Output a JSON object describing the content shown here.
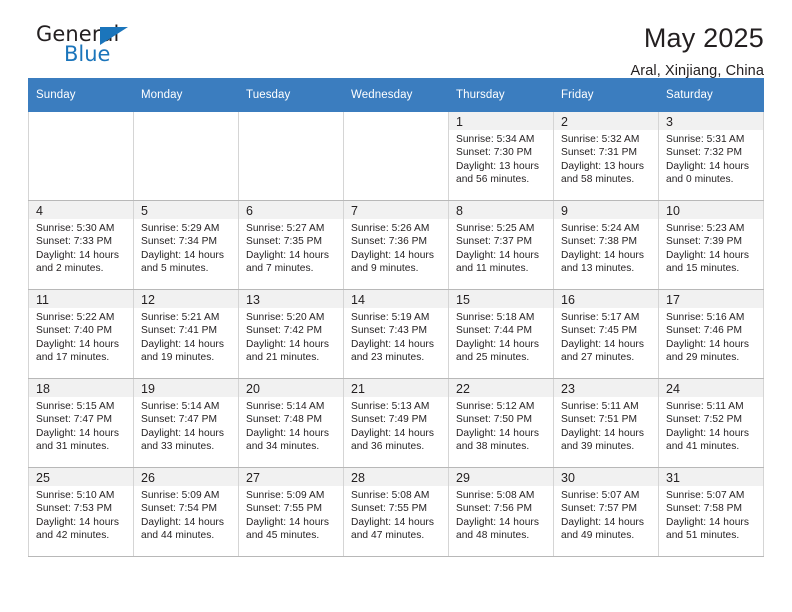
{
  "brand": {
    "name_top": "General",
    "name_bottom": "Blue",
    "accent_color": "#1b75bb"
  },
  "header": {
    "title": "May 2025",
    "subtitle": "Aral, Xinjiang, China"
  },
  "theme": {
    "header_row_color": "#3b7dbf",
    "header_text_color": "#ffffff",
    "cell_shade_color": "#f1f1f1",
    "grid_line_color": "#b8b8b8"
  },
  "calendar": {
    "weekday_headers": [
      "Sunday",
      "Monday",
      "Tuesday",
      "Wednesday",
      "Thursday",
      "Friday",
      "Saturday"
    ],
    "weeks": [
      [
        {
          "empty": true
        },
        {
          "empty": true
        },
        {
          "empty": true
        },
        {
          "empty": true
        },
        {
          "day": "1",
          "sunrise": "Sunrise: 5:34 AM",
          "sunset": "Sunset: 7:30 PM",
          "daylight_line1": "Daylight: 13 hours",
          "daylight_line2": "and 56 minutes."
        },
        {
          "day": "2",
          "sunrise": "Sunrise: 5:32 AM",
          "sunset": "Sunset: 7:31 PM",
          "daylight_line1": "Daylight: 13 hours",
          "daylight_line2": "and 58 minutes."
        },
        {
          "day": "3",
          "sunrise": "Sunrise: 5:31 AM",
          "sunset": "Sunset: 7:32 PM",
          "daylight_line1": "Daylight: 14 hours",
          "daylight_line2": "and 0 minutes."
        }
      ],
      [
        {
          "day": "4",
          "sunrise": "Sunrise: 5:30 AM",
          "sunset": "Sunset: 7:33 PM",
          "daylight_line1": "Daylight: 14 hours",
          "daylight_line2": "and 2 minutes."
        },
        {
          "day": "5",
          "sunrise": "Sunrise: 5:29 AM",
          "sunset": "Sunset: 7:34 PM",
          "daylight_line1": "Daylight: 14 hours",
          "daylight_line2": "and 5 minutes."
        },
        {
          "day": "6",
          "sunrise": "Sunrise: 5:27 AM",
          "sunset": "Sunset: 7:35 PM",
          "daylight_line1": "Daylight: 14 hours",
          "daylight_line2": "and 7 minutes."
        },
        {
          "day": "7",
          "sunrise": "Sunrise: 5:26 AM",
          "sunset": "Sunset: 7:36 PM",
          "daylight_line1": "Daylight: 14 hours",
          "daylight_line2": "and 9 minutes."
        },
        {
          "day": "8",
          "sunrise": "Sunrise: 5:25 AM",
          "sunset": "Sunset: 7:37 PM",
          "daylight_line1": "Daylight: 14 hours",
          "daylight_line2": "and 11 minutes."
        },
        {
          "day": "9",
          "sunrise": "Sunrise: 5:24 AM",
          "sunset": "Sunset: 7:38 PM",
          "daylight_line1": "Daylight: 14 hours",
          "daylight_line2": "and 13 minutes."
        },
        {
          "day": "10",
          "sunrise": "Sunrise: 5:23 AM",
          "sunset": "Sunset: 7:39 PM",
          "daylight_line1": "Daylight: 14 hours",
          "daylight_line2": "and 15 minutes."
        }
      ],
      [
        {
          "day": "11",
          "sunrise": "Sunrise: 5:22 AM",
          "sunset": "Sunset: 7:40 PM",
          "daylight_line1": "Daylight: 14 hours",
          "daylight_line2": "and 17 minutes."
        },
        {
          "day": "12",
          "sunrise": "Sunrise: 5:21 AM",
          "sunset": "Sunset: 7:41 PM",
          "daylight_line1": "Daylight: 14 hours",
          "daylight_line2": "and 19 minutes."
        },
        {
          "day": "13",
          "sunrise": "Sunrise: 5:20 AM",
          "sunset": "Sunset: 7:42 PM",
          "daylight_line1": "Daylight: 14 hours",
          "daylight_line2": "and 21 minutes."
        },
        {
          "day": "14",
          "sunrise": "Sunrise: 5:19 AM",
          "sunset": "Sunset: 7:43 PM",
          "daylight_line1": "Daylight: 14 hours",
          "daylight_line2": "and 23 minutes."
        },
        {
          "day": "15",
          "sunrise": "Sunrise: 5:18 AM",
          "sunset": "Sunset: 7:44 PM",
          "daylight_line1": "Daylight: 14 hours",
          "daylight_line2": "and 25 minutes."
        },
        {
          "day": "16",
          "sunrise": "Sunrise: 5:17 AM",
          "sunset": "Sunset: 7:45 PM",
          "daylight_line1": "Daylight: 14 hours",
          "daylight_line2": "and 27 minutes."
        },
        {
          "day": "17",
          "sunrise": "Sunrise: 5:16 AM",
          "sunset": "Sunset: 7:46 PM",
          "daylight_line1": "Daylight: 14 hours",
          "daylight_line2": "and 29 minutes."
        }
      ],
      [
        {
          "day": "18",
          "sunrise": "Sunrise: 5:15 AM",
          "sunset": "Sunset: 7:47 PM",
          "daylight_line1": "Daylight: 14 hours",
          "daylight_line2": "and 31 minutes."
        },
        {
          "day": "19",
          "sunrise": "Sunrise: 5:14 AM",
          "sunset": "Sunset: 7:47 PM",
          "daylight_line1": "Daylight: 14 hours",
          "daylight_line2": "and 33 minutes."
        },
        {
          "day": "20",
          "sunrise": "Sunrise: 5:14 AM",
          "sunset": "Sunset: 7:48 PM",
          "daylight_line1": "Daylight: 14 hours",
          "daylight_line2": "and 34 minutes."
        },
        {
          "day": "21",
          "sunrise": "Sunrise: 5:13 AM",
          "sunset": "Sunset: 7:49 PM",
          "daylight_line1": "Daylight: 14 hours",
          "daylight_line2": "and 36 minutes."
        },
        {
          "day": "22",
          "sunrise": "Sunrise: 5:12 AM",
          "sunset": "Sunset: 7:50 PM",
          "daylight_line1": "Daylight: 14 hours",
          "daylight_line2": "and 38 minutes."
        },
        {
          "day": "23",
          "sunrise": "Sunrise: 5:11 AM",
          "sunset": "Sunset: 7:51 PM",
          "daylight_line1": "Daylight: 14 hours",
          "daylight_line2": "and 39 minutes."
        },
        {
          "day": "24",
          "sunrise": "Sunrise: 5:11 AM",
          "sunset": "Sunset: 7:52 PM",
          "daylight_line1": "Daylight: 14 hours",
          "daylight_line2": "and 41 minutes."
        }
      ],
      [
        {
          "day": "25",
          "sunrise": "Sunrise: 5:10 AM",
          "sunset": "Sunset: 7:53 PM",
          "daylight_line1": "Daylight: 14 hours",
          "daylight_line2": "and 42 minutes."
        },
        {
          "day": "26",
          "sunrise": "Sunrise: 5:09 AM",
          "sunset": "Sunset: 7:54 PM",
          "daylight_line1": "Daylight: 14 hours",
          "daylight_line2": "and 44 minutes."
        },
        {
          "day": "27",
          "sunrise": "Sunrise: 5:09 AM",
          "sunset": "Sunset: 7:55 PM",
          "daylight_line1": "Daylight: 14 hours",
          "daylight_line2": "and 45 minutes."
        },
        {
          "day": "28",
          "sunrise": "Sunrise: 5:08 AM",
          "sunset": "Sunset: 7:55 PM",
          "daylight_line1": "Daylight: 14 hours",
          "daylight_line2": "and 47 minutes."
        },
        {
          "day": "29",
          "sunrise": "Sunrise: 5:08 AM",
          "sunset": "Sunset: 7:56 PM",
          "daylight_line1": "Daylight: 14 hours",
          "daylight_line2": "and 48 minutes."
        },
        {
          "day": "30",
          "sunrise": "Sunrise: 5:07 AM",
          "sunset": "Sunset: 7:57 PM",
          "daylight_line1": "Daylight: 14 hours",
          "daylight_line2": "and 49 minutes."
        },
        {
          "day": "31",
          "sunrise": "Sunrise: 5:07 AM",
          "sunset": "Sunset: 7:58 PM",
          "daylight_line1": "Daylight: 14 hours",
          "daylight_line2": "and 51 minutes."
        }
      ]
    ]
  }
}
